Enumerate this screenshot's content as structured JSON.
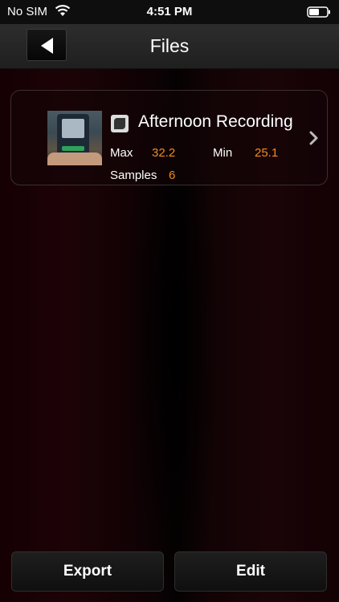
{
  "status_bar": {
    "carrier": "No SIM",
    "time": "4:51 PM",
    "wifi_icon": "wifi-icon",
    "battery_icon": "battery-icon"
  },
  "nav": {
    "title": "Files",
    "back_icon": "back-arrow-icon"
  },
  "files": [
    {
      "name": "Afternoon Recording",
      "max_label": "Max",
      "max_value": "32.2",
      "min_label": "Min",
      "min_value": "25.1",
      "samples_label": "Samples",
      "samples_value": "6",
      "type_icon": "recording-file-icon",
      "chevron_icon": "chevron-right-icon"
    }
  ],
  "footer": {
    "export_label": "Export",
    "edit_label": "Edit"
  },
  "colors": {
    "accent_value": "#f08a24",
    "background": "#150004"
  }
}
